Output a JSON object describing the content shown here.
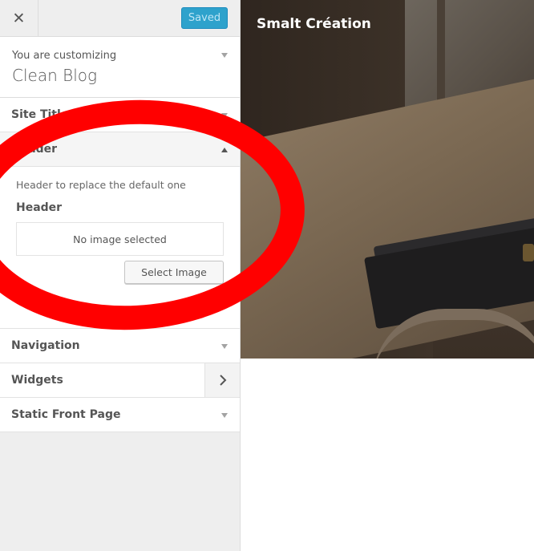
{
  "topbar": {
    "close_glyph": "✕",
    "saved_label": "Saved"
  },
  "info": {
    "customizing_label": "You are customizing",
    "theme_name": "Clean Blog"
  },
  "sections": {
    "site_title": "Site Title & Tagline",
    "header": "Header",
    "navigation": "Navigation",
    "widgets": "Widgets",
    "static_front_page": "Static Front Page"
  },
  "header_panel": {
    "description": "Header to replace the default one",
    "control_label": "Header",
    "no_image_text": "No image selected",
    "select_button": "Select Image"
  },
  "preview": {
    "site_title": "Smalt Création"
  },
  "colors": {
    "accent": "#2ea2cc",
    "annotation": "#ff0000"
  }
}
